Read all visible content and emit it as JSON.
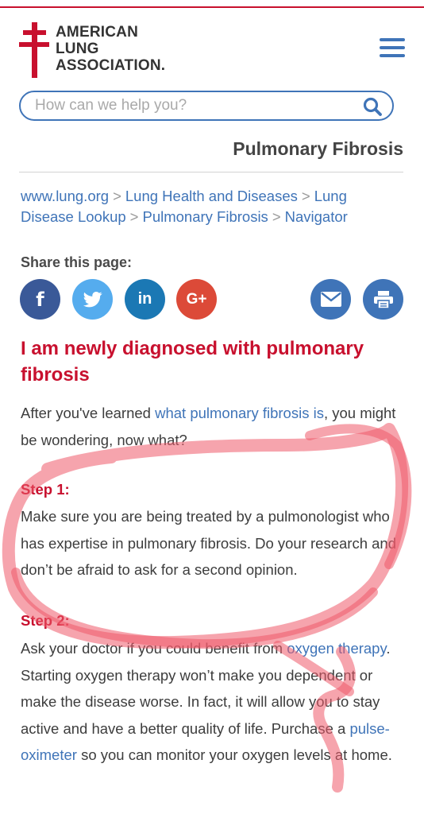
{
  "brand": {
    "line1": "AMERICAN",
    "line2": "LUNG",
    "line3": "ASSOCIATION.",
    "color_red": "#c8102e",
    "color_blue": "#3f74b8"
  },
  "header": {
    "menu_icon": "hamburger-menu-icon"
  },
  "search": {
    "placeholder": "How can we help you?",
    "icon": "search-icon"
  },
  "page": {
    "title": "Pulmonary Fibrosis"
  },
  "breadcrumb": {
    "items": [
      "www.lung.org",
      "Lung Health and Diseases",
      "Lung Disease Lookup",
      "Pulmonary Fibrosis",
      "Navigator"
    ],
    "separator": ">"
  },
  "share": {
    "label": "Share this page:",
    "buttons": [
      {
        "name": "facebook",
        "glyph": "f",
        "color": "#3a5998"
      },
      {
        "name": "twitter",
        "icon": "twitter-bird-icon",
        "color": "#55acee"
      },
      {
        "name": "linkedin",
        "glyph": "in",
        "color": "#1b78b4"
      },
      {
        "name": "google-plus",
        "glyph": "G+",
        "color": "#dc4a38"
      },
      {
        "name": "email",
        "icon": "envelope-icon",
        "color": "#3f74b8"
      },
      {
        "name": "print",
        "icon": "printer-icon",
        "color": "#3f74b8"
      }
    ]
  },
  "article": {
    "heading": "I am newly diagnosed with pulmonary fibrosis",
    "intro": {
      "before": "After you've learned ",
      "link": "what pulmonary fibrosis is",
      "after": ", you might be wondering, now what?"
    },
    "step1": {
      "label": "Step 1:",
      "text": "Make sure you are being treated by a pulmonologist who has expertise in pulmonary fibrosis. Do your research and don’t be afraid to ask for a second opinion."
    },
    "step2": {
      "label": "Step 2:",
      "text_before": "Ask your doctor if you could benefit from ",
      "link1": "oxygen therapy",
      "text_mid": ". Starting oxygen therapy won’t make you dependent or make the disease worse. In fact, it will allow you to stay active and have a better quality of life. Purchase a ",
      "link2": "pulse-oximeter",
      "text_after": " so you can monitor your oxygen levels at home."
    }
  },
  "annotation": {
    "color": "#ef5a6a"
  }
}
